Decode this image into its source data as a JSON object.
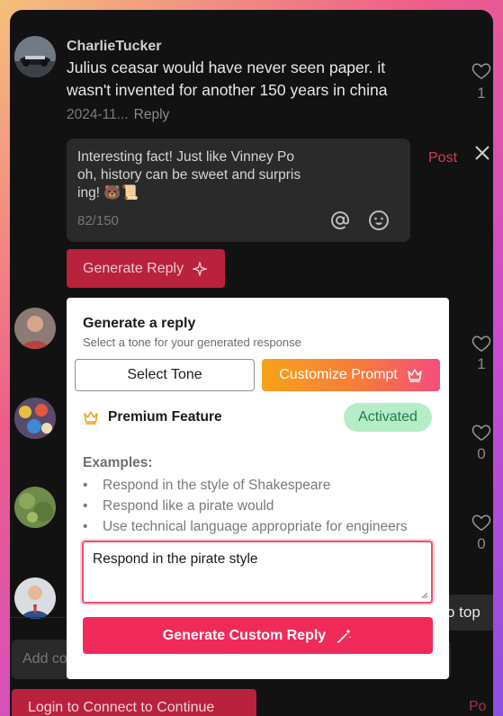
{
  "comment": {
    "username": "CharlieTucker",
    "text": "Julius ceasar would have never seen paper. it wasn't invented for another 150 years in china",
    "date": "2024-11...",
    "reply_label": "Reply",
    "likes": "1"
  },
  "reply_editor": {
    "text": "Interesting fact! Just like Vinney Po oh, history can be sweet and surpris ing! 🐻📜",
    "line1": "Interesting fact! Just like Vinney Po",
    "line2": "oh, history can be sweet and surpris",
    "line3": "ing! 🐻📜",
    "char_count": "82/150",
    "post_label": "Post",
    "close_icon": "close-icon",
    "mention_icon": "at-icon",
    "emoji_icon": "emoji-icon"
  },
  "generate_reply_button": {
    "label": "Generate Reply",
    "icon": "sparkle-icon"
  },
  "side_likes": [
    "1",
    "0",
    "0"
  ],
  "modal": {
    "title": "Generate a reply",
    "subtitle": "Select a tone for your generated response",
    "select_tone_label": "Select Tone",
    "customize_label": "Customize Prompt",
    "premium_label": "Premium Feature",
    "activated_label": "Activated",
    "examples_title": "Examples:",
    "examples": [
      "Respond in the style of Shakespeare",
      "Respond like a pirate would",
      "Use technical language appropriate for engineers"
    ],
    "prompt_value": "Respond in the pirate style",
    "generate_custom_label": "Generate Custom Reply"
  },
  "back_to_top_label": "o top",
  "add_comment_placeholder": "Add co",
  "login_label": "Login to Connect to Continue",
  "bottom_post_label": "Po",
  "colors": {
    "accent": "#f02a59",
    "brand_red": "#b8223d",
    "activated_bg": "#b6ecc8",
    "activated_text": "#1e7d45"
  }
}
